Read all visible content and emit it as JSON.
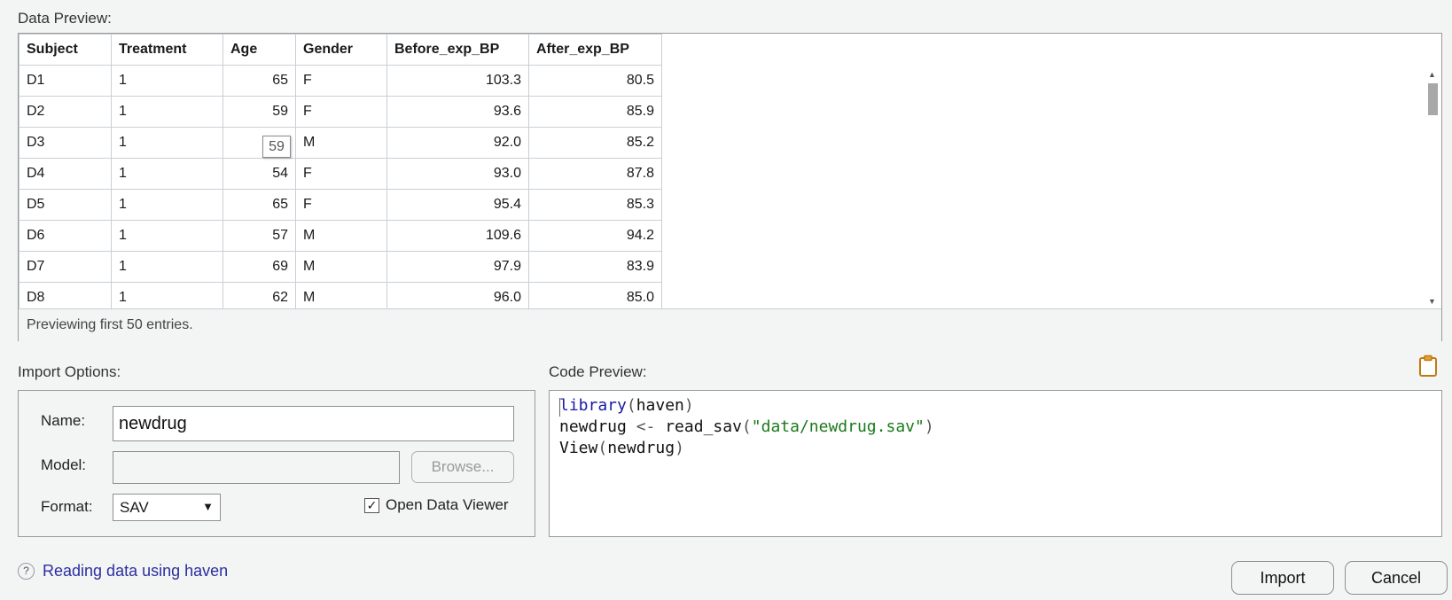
{
  "data_preview": {
    "label": "Data Preview:",
    "columns": [
      "Subject",
      "Treatment",
      "Age",
      "Gender",
      "Before_exp_BP",
      "After_exp_BP"
    ],
    "rows": [
      [
        "D1",
        "1",
        "65",
        "F",
        "103.3",
        "80.5"
      ],
      [
        "D2",
        "1",
        "59",
        "F",
        "93.6",
        "85.9"
      ],
      [
        "D3",
        "1",
        "",
        "M",
        "92.0",
        "85.2"
      ],
      [
        "D4",
        "1",
        "54",
        "F",
        "93.0",
        "87.8"
      ],
      [
        "D5",
        "1",
        "65",
        "F",
        "95.4",
        "85.3"
      ],
      [
        "D6",
        "1",
        "57",
        "M",
        "109.6",
        "94.2"
      ],
      [
        "D7",
        "1",
        "69",
        "M",
        "97.9",
        "83.9"
      ],
      [
        "D8",
        "1",
        "62",
        "M",
        "96.0",
        "85.0"
      ]
    ],
    "tooltip_value": "59",
    "footer": "Previewing first 50 entries."
  },
  "import_options": {
    "label": "Import Options:",
    "name_label": "Name:",
    "name_value": "newdrug",
    "model_label": "Model:",
    "model_value": "",
    "browse_label": "Browse...",
    "format_label": "Format:",
    "format_value": "SAV",
    "open_viewer_label": "Open Data Viewer",
    "open_viewer_checked": true
  },
  "code_preview": {
    "label": "Code Preview:",
    "line1": {
      "fn": "library",
      "open": "(",
      "arg": "haven",
      "close": ")"
    },
    "line2": {
      "var": "newdrug",
      "assign": " <- ",
      "fn": "read_sav",
      "open": "(",
      "str": "\"data/newdrug.sav\"",
      "close": ")"
    },
    "line3": {
      "fn": "View",
      "open": "(",
      "arg": "newdrug",
      "close": ")"
    }
  },
  "help_link": "Reading data using haven",
  "buttons": {
    "import": "Import",
    "cancel": "Cancel"
  },
  "icons": {
    "help": "question-circle-icon",
    "clipboard": "clipboard-icon",
    "check": "checkmark-icon"
  },
  "colors": {
    "keyword": "#1a1aa6",
    "string": "#1a7a1a",
    "link": "#2a2fa0",
    "background": "#f3f4f4"
  }
}
